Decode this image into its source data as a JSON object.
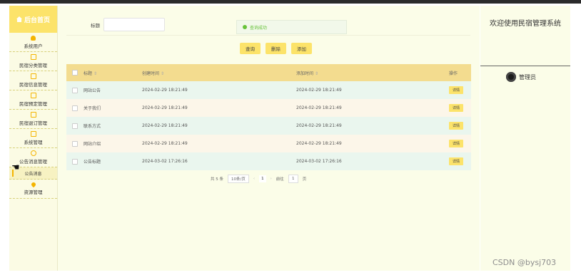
{
  "sidebar": {
    "title": "后台首页",
    "items": [
      {
        "label": "系统用户",
        "icon": "user-icon"
      },
      {
        "label": "民宿分类管理",
        "icon": "grid-icon"
      },
      {
        "label": "民宿信息管理",
        "icon": "grid-icon"
      },
      {
        "label": "民宿预定管理",
        "icon": "grid-icon"
      },
      {
        "label": "民宿退订管理",
        "icon": "grid-icon"
      },
      {
        "label": "系统管理",
        "icon": "grid-icon"
      },
      {
        "label": "公告消息管理",
        "icon": "bell-icon"
      }
    ],
    "sub_item": "公告消息",
    "last_item": {
      "label": "资源管理",
      "icon": "pin-icon"
    }
  },
  "search": {
    "label": "标题",
    "value": "",
    "placeholder": ""
  },
  "toast": {
    "text": "查询成功"
  },
  "buttons": {
    "query": "查询",
    "delete": "删除",
    "add": "添加"
  },
  "table": {
    "headers": [
      "标题",
      "创建时间",
      "添加时间",
      "操作"
    ],
    "rows": [
      {
        "title": "网站公告",
        "created": "2024-02-29 18:21:49",
        "added": "2024-02-29 18:21:49",
        "action": "详情"
      },
      {
        "title": "关于我们",
        "created": "2024-02-29 18:21:49",
        "added": "2024-02-29 18:21:49",
        "action": "详情"
      },
      {
        "title": "联系方式",
        "created": "2024-02-29 18:21:49",
        "added": "2024-02-29 18:21:49",
        "action": "详情"
      },
      {
        "title": "网站介绍",
        "created": "2024-02-29 18:21:49",
        "added": "2024-02-29 18:21:49",
        "action": "详情"
      },
      {
        "title": "公告标题",
        "created": "2024-03-02 17:26:16",
        "added": "2024-03-02 17:26:16",
        "action": "详情"
      }
    ]
  },
  "pagination": {
    "total": "共 5 条",
    "page_size": "10条/页",
    "current": "1",
    "goto_label": "前往",
    "goto_value": "1",
    "page_suffix": "页"
  },
  "right": {
    "welcome": "欢迎使用民宿管理系统",
    "user": "管理员"
  },
  "watermark": "CSDN @bysj703",
  "colors": {
    "accent": "#fce36a",
    "header": "#f3dc8f",
    "panel": "#fbfde8",
    "success": "#67c23a"
  }
}
